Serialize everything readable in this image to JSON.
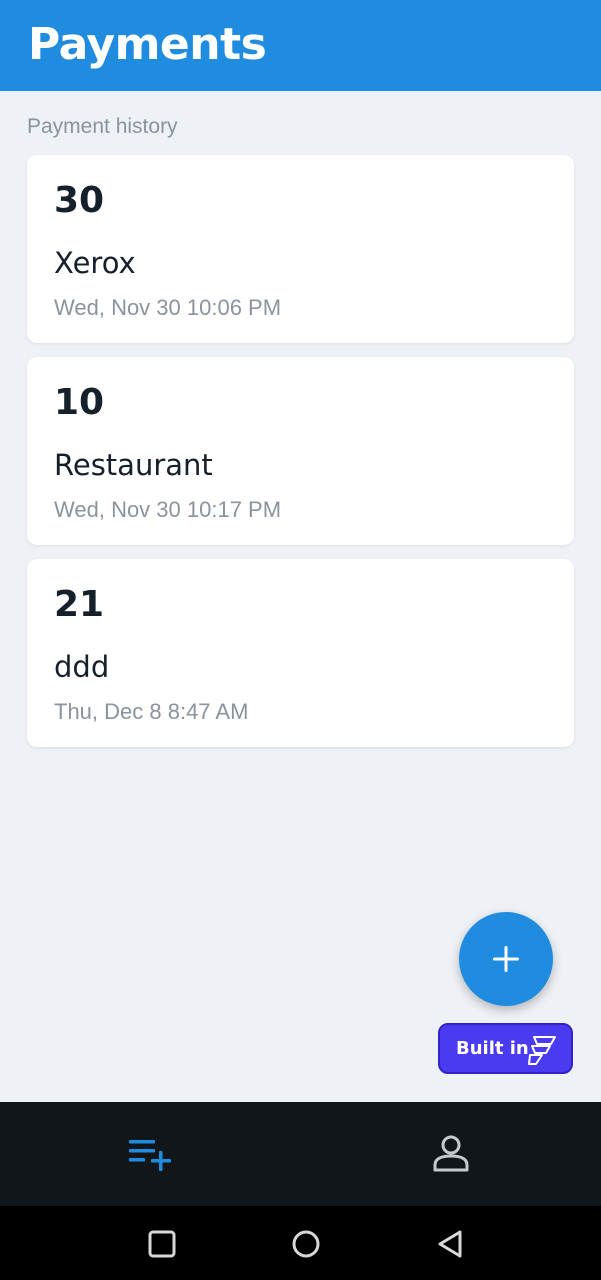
{
  "header": {
    "title": "Payments"
  },
  "history": {
    "label": "Payment history",
    "items": [
      {
        "amount": "30",
        "name": "Xerox",
        "date": "Wed, Nov 30 10:06 PM"
      },
      {
        "amount": "10",
        "name": "Restaurant",
        "date": "Wed, Nov 30 10:17 PM"
      },
      {
        "amount": "21",
        "name": "ddd",
        "date": "Thu, Dec 8 8:47 AM"
      }
    ]
  },
  "fab": {
    "icon": "plus-icon"
  },
  "badge": {
    "text": "Built in",
    "icon": "flutterflow-logo-icon"
  },
  "bottom_nav": {
    "items": [
      {
        "icon": "playlist-add-icon",
        "active": true
      },
      {
        "icon": "person-icon",
        "active": false
      }
    ]
  },
  "system_nav": {
    "icons": [
      "square-icon",
      "circle-icon",
      "back-triangle-icon"
    ]
  },
  "colors": {
    "primary": "#1f8ce0",
    "background": "#eef1f5",
    "nav_background": "#11161b",
    "badge": "#4b3bf0"
  }
}
